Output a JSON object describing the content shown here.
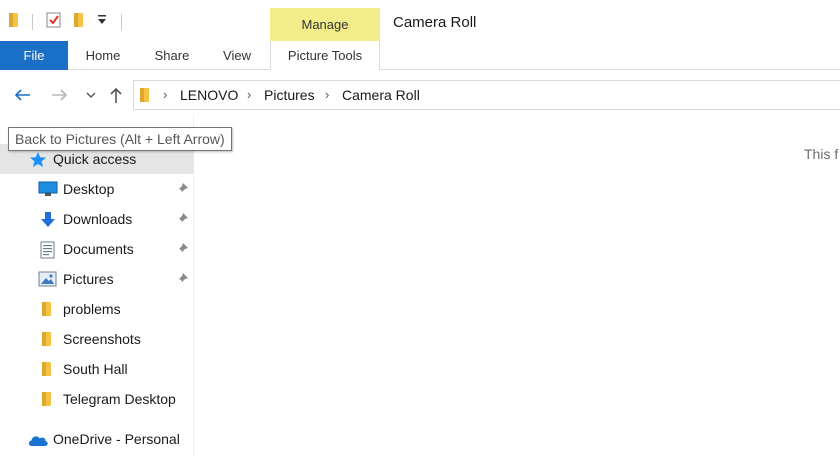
{
  "window": {
    "title": "Camera Roll"
  },
  "quick_access_toolbar": {
    "icons": [
      "folder-icon",
      "properties-checkbox-icon",
      "new-folder-icon",
      "customize-dropdown-icon"
    ]
  },
  "ribbon": {
    "contextual_group": "Manage",
    "tabs": [
      {
        "label": "File"
      },
      {
        "label": "Home"
      },
      {
        "label": "Share"
      },
      {
        "label": "View"
      },
      {
        "label": "Picture Tools"
      }
    ]
  },
  "address_bar": {
    "crumbs": [
      "LENOVO",
      "Pictures",
      "Camera Roll"
    ]
  },
  "tooltip": {
    "text": "Back to Pictures (Alt + Left Arrow)"
  },
  "nav_pane": {
    "items": [
      {
        "label": "Quick access",
        "icon": "star-icon"
      },
      {
        "label": "Desktop",
        "icon": "desktop-icon",
        "pinned": true
      },
      {
        "label": "Downloads",
        "icon": "download-arrow-icon",
        "pinned": true
      },
      {
        "label": "Documents",
        "icon": "document-icon",
        "pinned": true
      },
      {
        "label": "Pictures",
        "icon": "picture-icon",
        "pinned": true
      },
      {
        "label": "problems",
        "icon": "folder-icon"
      },
      {
        "label": "Screenshots",
        "icon": "folder-icon"
      },
      {
        "label": "South Hall",
        "icon": "folder-icon"
      },
      {
        "label": "Telegram Desktop",
        "icon": "folder-icon"
      },
      {
        "label": "OneDrive - Personal",
        "icon": "cloud-icon"
      }
    ]
  },
  "content": {
    "empty_message": "This f"
  },
  "colors": {
    "file_tab": "#1a6fc7",
    "manage_tab": "#f2ec8a",
    "nav_arrow": "#1a6fc7"
  }
}
